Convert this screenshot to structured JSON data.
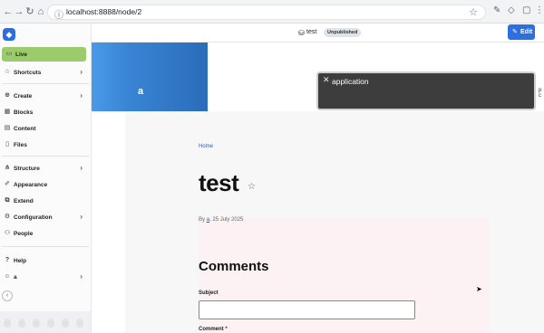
{
  "browser": {
    "url": "localhost:8888/node/2",
    "nav": {
      "back": "←",
      "forward": "→",
      "reload": "↻",
      "home": "⌂"
    }
  },
  "sidebar": {
    "items": [
      {
        "label": "Live",
        "icon": "live-icon"
      },
      {
        "label": "Shortcuts",
        "icon": "star-icon"
      },
      {
        "label": "Create",
        "icon": "plus-icon"
      },
      {
        "label": "Blocks",
        "icon": "blocks-icon"
      },
      {
        "label": "Content",
        "icon": "content-icon"
      },
      {
        "label": "Files",
        "icon": "file-icon"
      },
      {
        "label": "Structure",
        "icon": "structure-icon"
      },
      {
        "label": "Appearance",
        "icon": "brush-icon"
      },
      {
        "label": "Extend",
        "icon": "extend-icon"
      },
      {
        "label": "Configuration",
        "icon": "gear-icon"
      },
      {
        "label": "People",
        "icon": "people-icon"
      },
      {
        "label": "Help",
        "icon": "help-icon"
      },
      {
        "label": "a",
        "icon": "user-icon"
      }
    ]
  },
  "topbar": {
    "title": "test",
    "status": "Unpublished",
    "edit_label": "Edit"
  },
  "page": {
    "hero_label": "a",
    "breadcrumb": "Home",
    "title": "test",
    "byline_prefix": "By",
    "byline_author": "a",
    "byline_date": ", 25 July 2025",
    "comments_heading": "Comments",
    "subject_label": "Subject",
    "comment_label": "Comment",
    "required_mark": "*"
  },
  "toast": {
    "message": "application",
    "close": "✕"
  },
  "edge_text": "p c"
}
